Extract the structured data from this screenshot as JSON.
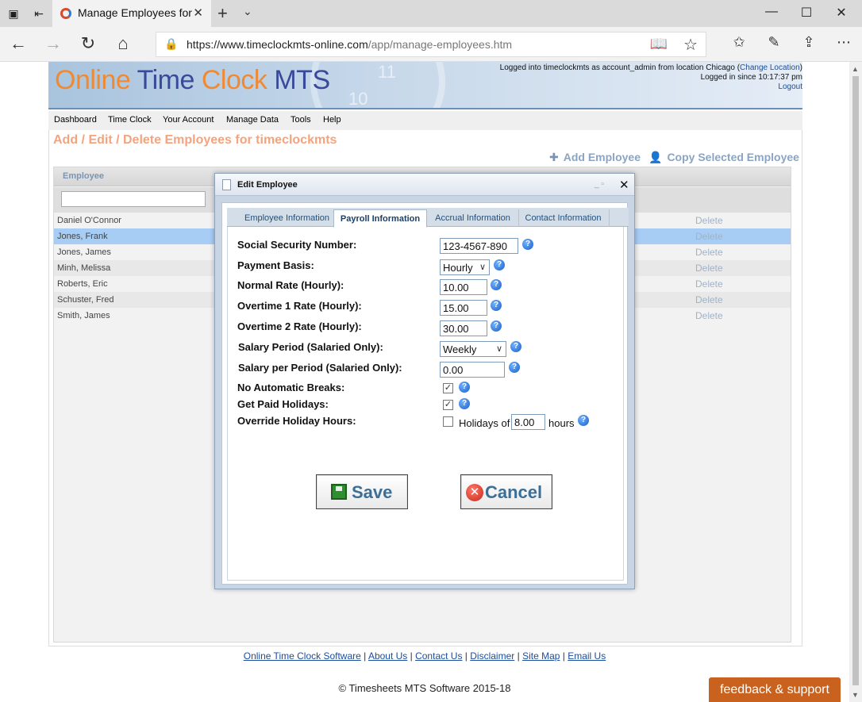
{
  "browser": {
    "tab_title": "Manage Employees for",
    "url_host": "https://www.timeclockmts-online.com",
    "url_path": "/app/manage-employees.htm"
  },
  "header": {
    "logo_words": [
      "Online",
      "Time",
      "Clock",
      "MTS"
    ],
    "login_prefix": "Logged into timeclockmts as account_admin from location Chicago (",
    "change_location": "Change Location",
    "login_suffix": ")",
    "logged_since": "Logged in since 10:17:37 pm",
    "logout": "Logout"
  },
  "menu": [
    "Dashboard",
    "Time Clock",
    "Your Account",
    "Manage Data",
    "Tools",
    "Help"
  ],
  "page": {
    "title": "Add / Edit / Delete Employees for timeclockmts",
    "add_employee": "Add Employee",
    "copy_employee": "Copy Selected Employee",
    "grid_header": "Employee",
    "delete_label": "Delete",
    "employees": [
      "Daniel O'Connor",
      "Jones, Frank",
      "Jones, James",
      "Minh, Melissa",
      "Roberts, Eric",
      "Schuster, Fred",
      "Smith, James"
    ],
    "selected_index": 1
  },
  "modal": {
    "title": "Edit Employee",
    "tabs": [
      "Employee Information",
      "Payroll Information",
      "Accrual Information",
      "Contact Information"
    ],
    "active_tab": "Payroll Information",
    "fields": {
      "ssn_label": "Social Security Number:",
      "ssn_value": "123-4567-890",
      "payment_basis_label": "Payment Basis:",
      "payment_basis_value": "Hourly",
      "normal_rate_label": "Normal Rate (Hourly):",
      "normal_rate_value": "10.00",
      "ot1_label": "Overtime 1 Rate (Hourly):",
      "ot1_value": "15.00",
      "ot2_label": "Overtime 2 Rate (Hourly):",
      "ot2_value": "30.00",
      "salary_period_label": "Salary Period (Salaried Only):",
      "salary_period_value": "Weekly",
      "salary_per_period_label": "Salary per Period (Salaried Only):",
      "salary_per_period_value": "0.00",
      "no_auto_breaks_label": "No Automatic Breaks:",
      "get_paid_holidays_label": "Get Paid Holidays:",
      "override_holiday_label": "Override Holiday Hours:",
      "holidays_of": "Holidays of",
      "holiday_hours_value": "8.00",
      "hours": "hours"
    },
    "save_label": "Save",
    "cancel_label": "Cancel"
  },
  "footer": {
    "links": [
      "Online Time Clock Software",
      "About Us",
      "Contact Us",
      "Disclaimer",
      "Site Map",
      "Email Us"
    ],
    "copyright": "© Timesheets MTS Software 2015-18",
    "feedback": "feedback & support"
  }
}
